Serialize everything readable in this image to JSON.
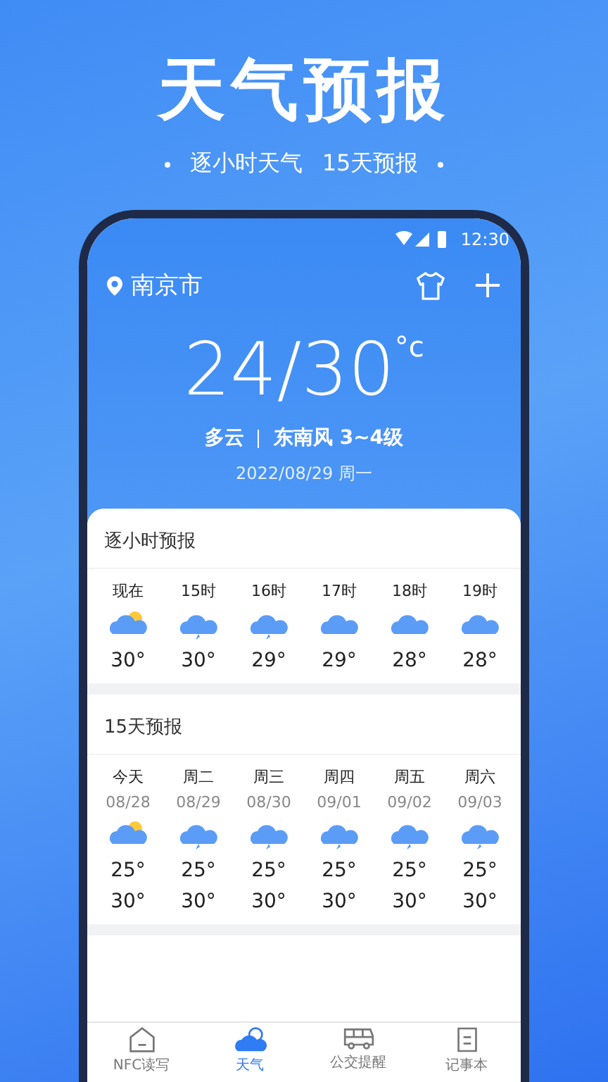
{
  "headline": "天气预报",
  "subtitle": [
    "逐小时天气",
    "15天预报"
  ],
  "status_bar": {
    "time": "12:30"
  },
  "location": {
    "city": "南京市"
  },
  "current": {
    "temperature": "24/30",
    "unit": "°c",
    "condition": "多云",
    "wind": "东南风 3~4级",
    "date": "2022/08/29 周一"
  },
  "hourly": {
    "title": "逐小时预报",
    "items": [
      {
        "time": "现在",
        "kind": "sun",
        "temp": "30°"
      },
      {
        "time": "15时",
        "kind": "storm",
        "temp": "30°"
      },
      {
        "time": "16时",
        "kind": "storm",
        "temp": "29°"
      },
      {
        "time": "17时",
        "kind": "cloud",
        "temp": "29°"
      },
      {
        "time": "18时",
        "kind": "cloud",
        "temp": "28°"
      },
      {
        "time": "19时",
        "kind": "cloud",
        "temp": "28°"
      }
    ]
  },
  "daily": {
    "title": "15天预报",
    "items": [
      {
        "day": "今天",
        "date": "08/28",
        "kind": "sun",
        "low": "25°",
        "high": "30°"
      },
      {
        "day": "周二",
        "date": "08/29",
        "kind": "storm",
        "low": "25°",
        "high": "30°"
      },
      {
        "day": "周三",
        "date": "08/30",
        "kind": "storm",
        "low": "25°",
        "high": "30°"
      },
      {
        "day": "周四",
        "date": "09/01",
        "kind": "storm",
        "low": "25°",
        "high": "30°"
      },
      {
        "day": "周五",
        "date": "09/02",
        "kind": "storm",
        "low": "25°",
        "high": "30°"
      },
      {
        "day": "周六",
        "date": "09/03",
        "kind": "storm",
        "low": "25°",
        "high": "30°"
      }
    ]
  },
  "tabs": [
    {
      "label": "NFC读写",
      "kind": "home",
      "selected": false
    },
    {
      "label": "天气",
      "kind": "weather",
      "selected": true
    },
    {
      "label": "公交提醒",
      "kind": "bus",
      "selected": false
    },
    {
      "label": "记事本",
      "kind": "note",
      "selected": false
    }
  ]
}
